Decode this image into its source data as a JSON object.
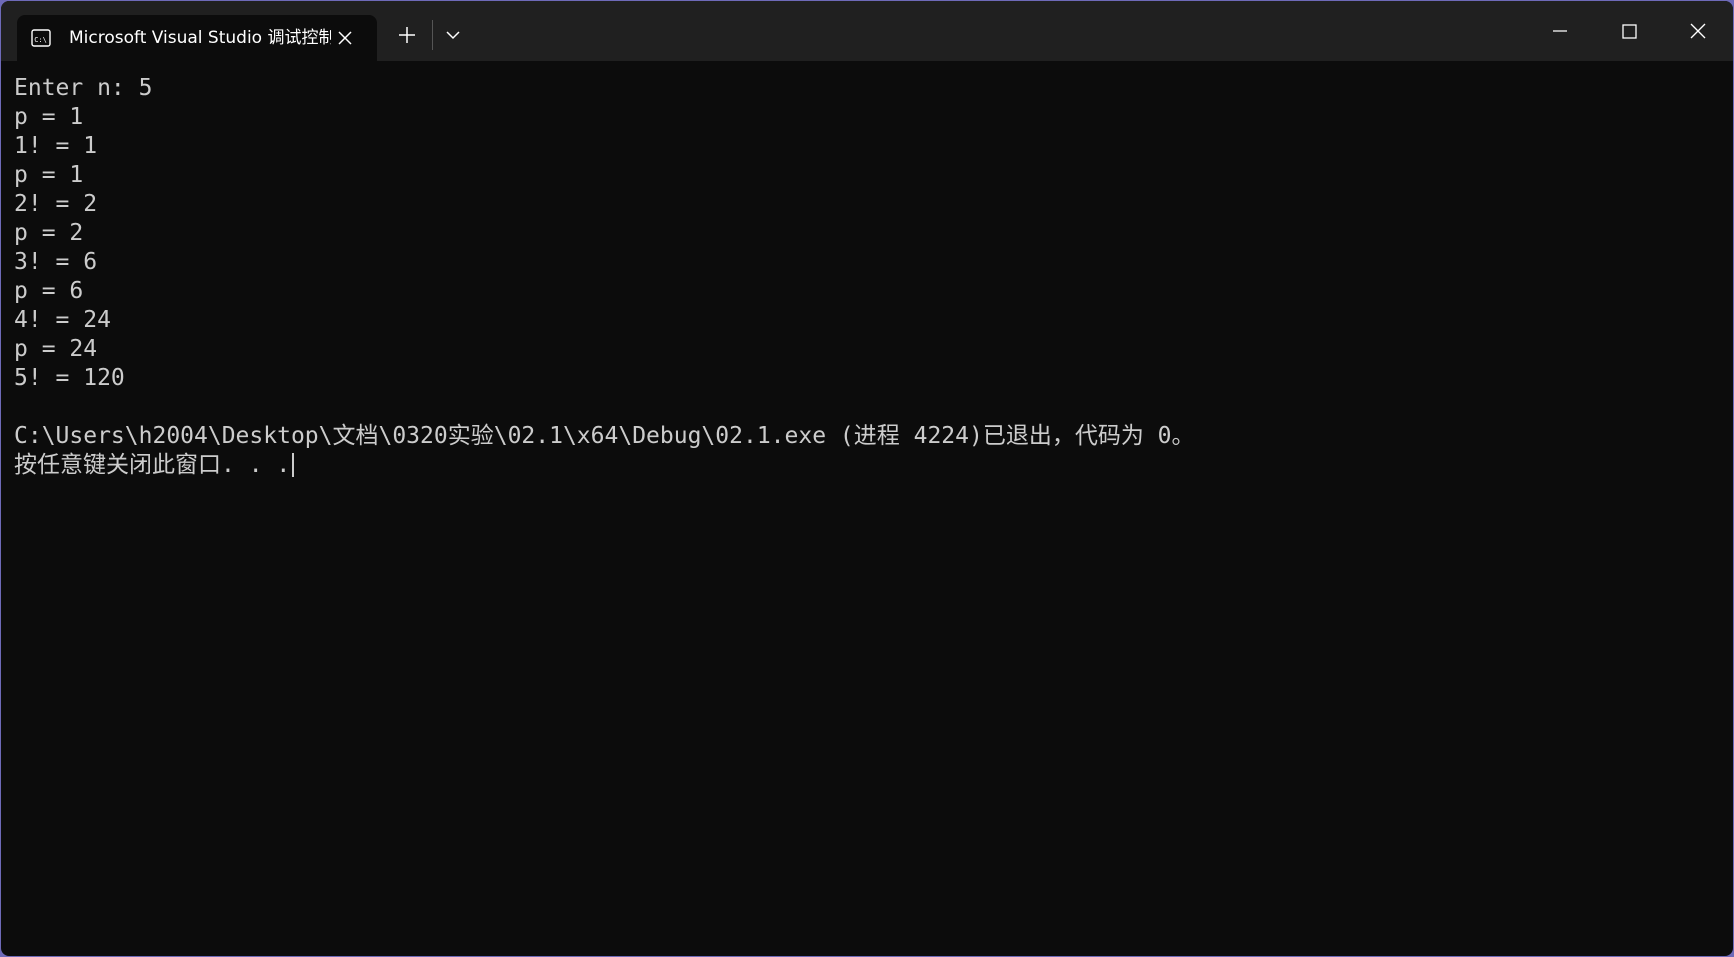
{
  "window": {
    "tab_title": "Microsoft Visual Studio 调试控制台",
    "tab_icon": "console-icon",
    "colors": {
      "titlebar": "#202020",
      "background": "#0c0c0c",
      "text": "#cccccc"
    }
  },
  "console": {
    "lines": [
      "Enter n: 5",
      "p = 1",
      "1! = 1",
      "p = 1",
      "2! = 2",
      "p = 2",
      "3! = 6",
      "p = 6",
      "4! = 24",
      "p = 24",
      "5! = 120",
      "",
      "C:\\Users\\h2004\\Desktop\\文档\\0320实验\\02.1\\x64\\Debug\\02.1.exe (进程 4224)已退出，代码为 0。",
      "按任意键关闭此窗口. . ."
    ]
  }
}
